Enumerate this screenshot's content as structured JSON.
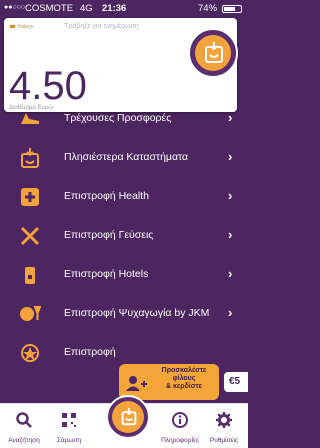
{
  "status_bar": {
    "signal": "●●○○○",
    "carrier": "COSMOTE",
    "network": "4G",
    "time": "21:36",
    "battery": "74%"
  },
  "card": {
    "logo": "Yodeyo",
    "select_prompt": "Τράβηξε για ενημέρωση",
    "balance": "4.50",
    "balance_label": "Διαθέσιμα Ευρώ"
  },
  "menu": [
    {
      "label": "Τρέχουσες Προσφορές",
      "icon": "shoe-icon"
    },
    {
      "label": "Πλησιέστερα Καταστήματα",
      "icon": "store-icon"
    },
    {
      "label": "Επιστροφή Health",
      "icon": "health-cross-icon"
    },
    {
      "label": "Επιστροφή Γεύσεις",
      "icon": "utensils-icon"
    },
    {
      "label": "Επιστροφή Hotels",
      "icon": "hotel-icon"
    },
    {
      "label": "Επιστροφή Ψυχαγωγία by JKM",
      "icon": "entertainment-icon"
    },
    {
      "label": "Επιστροφή",
      "icon": "star-circle-icon"
    }
  ],
  "invite_tooltip": {
    "line1": "Προσκαλέστε",
    "line2": "φίλους",
    "line3": "& κερδίστε",
    "amount": "€5"
  },
  "tabbar": {
    "search": "Αναζήτηση",
    "scan": "Σάρωση",
    "info": "Πληροφορίες",
    "settings": "Ρυθμίσεις"
  },
  "colors": {
    "primary": "#4d2560",
    "accent": "#f3a23c"
  }
}
